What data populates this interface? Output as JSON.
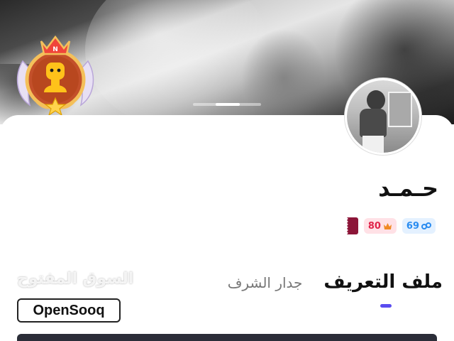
{
  "profile": {
    "name": "حـمـد",
    "stats": {
      "followers": "69",
      "points": "80"
    },
    "badge_letter": "N"
  },
  "tabs": [
    {
      "label": "ملف التعريف",
      "active": true
    },
    {
      "label": "جدار الشرف",
      "active": false
    }
  ],
  "watermark": {
    "arabic": "السوق المفتوح",
    "latin": "OpenSooq"
  },
  "colors": {
    "accent": "#5a4cf0",
    "blue_chip": "#2a8cf0",
    "red_chip": "#e0244a",
    "flag": "#8c1538"
  },
  "icons": [
    "rank-badge-icon",
    "crown-icon",
    "link-icon",
    "qatar-flag-icon"
  ]
}
